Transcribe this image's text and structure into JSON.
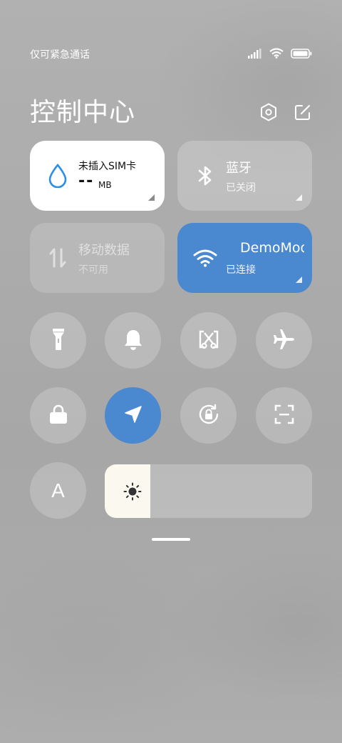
{
  "status": {
    "carrier": "仅可紧急通话",
    "icons": [
      "signal-icon",
      "wifi-icon",
      "battery-icon"
    ]
  },
  "header": {
    "title": "控制中心",
    "actions": [
      "settings-icon",
      "edit-icon"
    ]
  },
  "tiles": {
    "sim": {
      "title": "未插入SIM卡",
      "value": "--",
      "unit": "MB",
      "icon": "water-drop-icon"
    },
    "bluetooth": {
      "title": "蓝牙",
      "subtitle": "已关闭",
      "icon": "bluetooth-icon"
    },
    "mobile_data": {
      "title": "移动数据",
      "subtitle": "不可用",
      "icon": "data-arrows-icon"
    },
    "wifi": {
      "title": "DemoMode",
      "subtitle": "已连接",
      "icon": "wifi-icon"
    }
  },
  "toggles_row1": [
    "flashlight-icon",
    "bell-icon",
    "screenshot-icon",
    "airplane-icon"
  ],
  "toggles_row2": [
    "lock-icon",
    "location-icon",
    "rotation-lock-icon",
    "scan-icon"
  ],
  "font_toggle": {
    "label": "A"
  },
  "brightness": {
    "level": 0.22,
    "icon": "sun-icon"
  },
  "colors": {
    "accent": "#4a88cf",
    "tile_white": "#ffffff",
    "brightness_fill": "#fbf8f0"
  }
}
